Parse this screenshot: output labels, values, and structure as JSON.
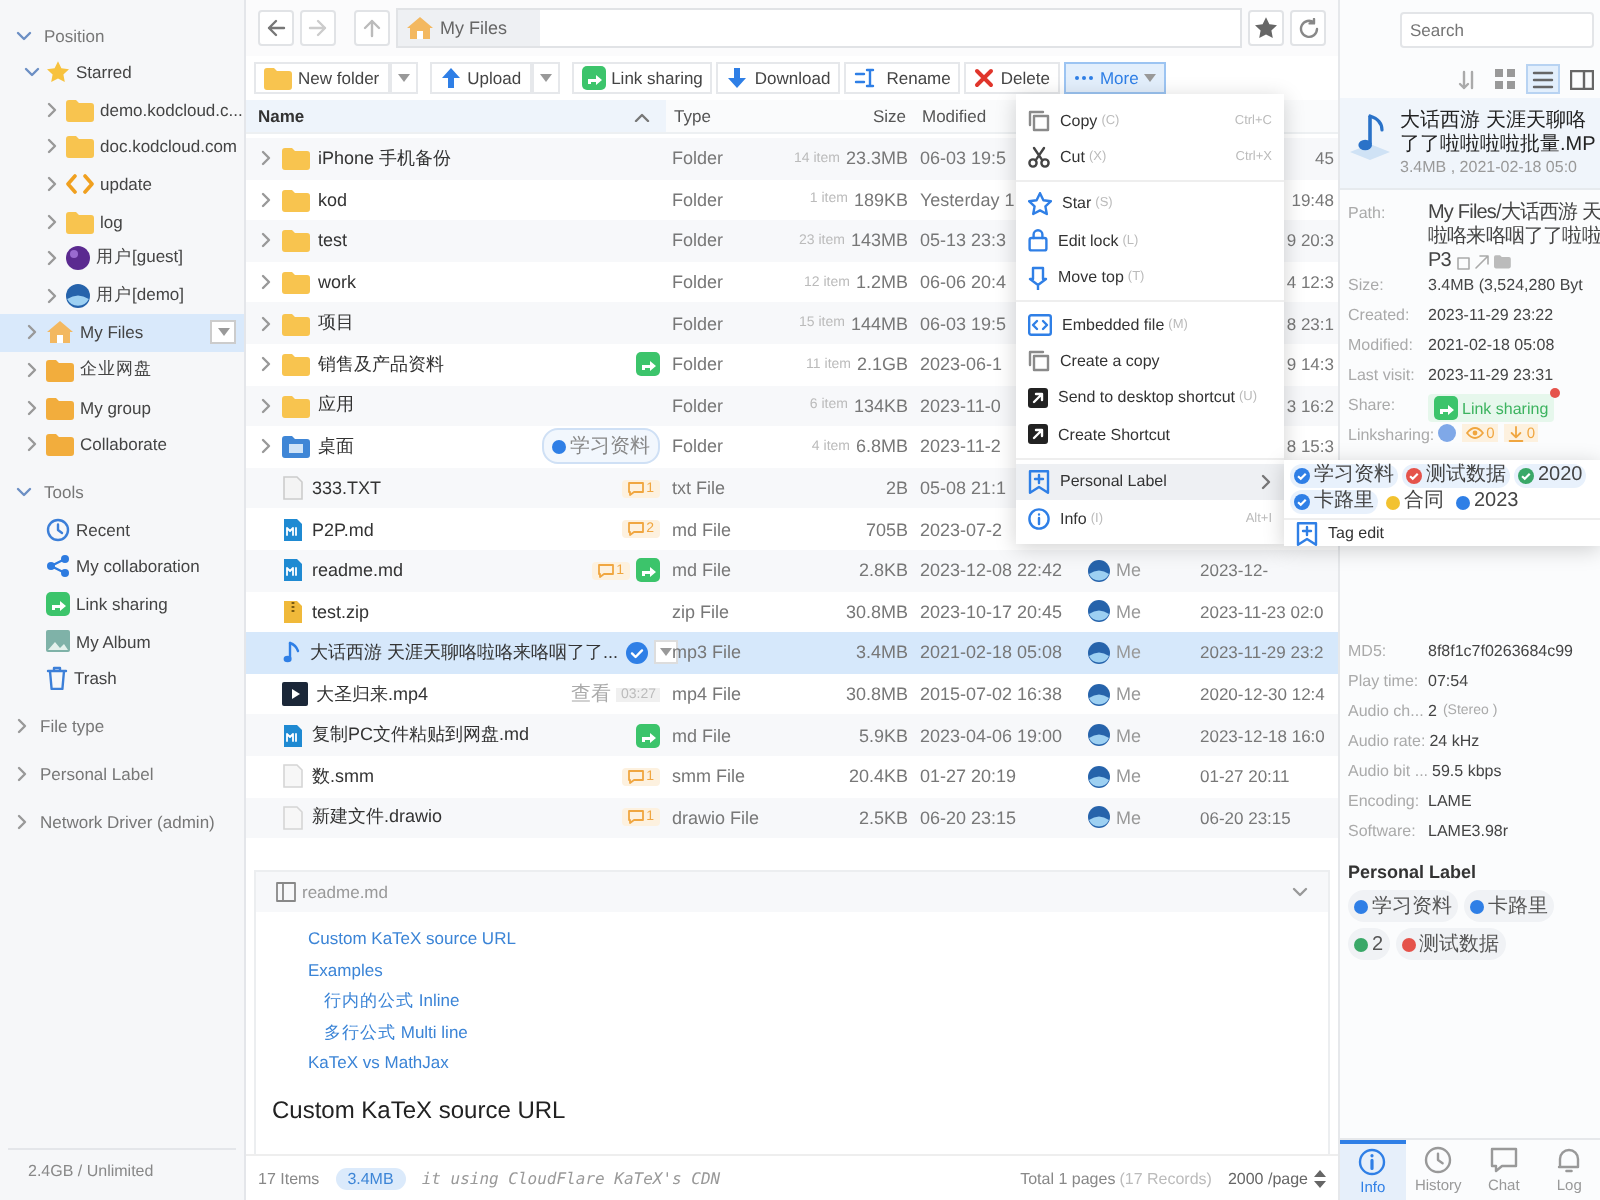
{
  "sidebar": {
    "sections": [
      {
        "title": "Position",
        "expanded": true,
        "items": [
          {
            "label": "Starred",
            "kind": "star",
            "expanded": true,
            "selected": false,
            "children": [
              {
                "label": "demo.kodcloud.c...",
                "kind": "folder",
                "expanded": false,
                "selected": false
              },
              {
                "label": "doc.kodcloud.com",
                "kind": "folder",
                "expanded": false,
                "selected": false
              },
              {
                "label": "update",
                "kind": "code",
                "expanded": false,
                "selected": false
              },
              {
                "label": "log",
                "kind": "folder",
                "expanded": false,
                "selected": false
              },
              {
                "label": "用户[guest]",
                "kind": "user-purple",
                "expanded": false,
                "selected": false
              },
              {
                "label": "用户[demo]",
                "kind": "user-blue",
                "expanded": false,
                "selected": false
              }
            ]
          },
          {
            "label": "My Files",
            "kind": "home",
            "expanded": false,
            "selected": true,
            "menu": true
          },
          {
            "label": "企业网盘",
            "kind": "folder-orange",
            "expanded": false,
            "selected": false
          },
          {
            "label": "My group",
            "kind": "folder-orange",
            "expanded": false,
            "selected": false
          },
          {
            "label": "Collaborate",
            "kind": "folder-orange",
            "expanded": false,
            "selected": false
          }
        ]
      },
      {
        "title": "Tools",
        "expanded": true,
        "items": [
          {
            "label": "Recent",
            "kind": "recent",
            "selected": false
          },
          {
            "label": "My collaboration",
            "kind": "collab",
            "selected": false
          },
          {
            "label": "Link sharing",
            "kind": "link-share",
            "selected": false
          },
          {
            "label": "My Album",
            "kind": "album",
            "selected": false
          },
          {
            "label": "Trash",
            "kind": "trash",
            "selected": false
          }
        ]
      },
      {
        "title": "File type",
        "expanded": false
      },
      {
        "title": "Personal Label",
        "expanded": false
      },
      {
        "title": "Network Driver (admin)",
        "expanded": false
      }
    ],
    "storage": "2.4GB / Unlimited"
  },
  "address_bar": {
    "breadcrumb": "My Files"
  },
  "search": {
    "placeholder": "Search"
  },
  "toolbar": [
    {
      "label": "New folder",
      "kind": "new-folder",
      "dropdown": true,
      "selected": false
    },
    {
      "label": "Upload",
      "kind": "upload",
      "dropdown": true,
      "selected": false
    },
    {
      "label": "Link sharing",
      "kind": "share",
      "dropdown": false,
      "selected": false
    },
    {
      "label": "Download",
      "kind": "download",
      "dropdown": false,
      "selected": false
    },
    {
      "label": "Rename",
      "kind": "rename",
      "dropdown": false,
      "selected": false
    },
    {
      "label": "Delete",
      "kind": "delete",
      "dropdown": false,
      "selected": false
    },
    {
      "label": "More",
      "kind": "more",
      "dropdown": true,
      "selected": true
    }
  ],
  "view_modes": [
    {
      "kind": "sort",
      "selected": false
    },
    {
      "kind": "grid",
      "selected": false
    },
    {
      "kind": "list",
      "selected": true
    },
    {
      "kind": "split",
      "selected": false
    }
  ],
  "table": {
    "columns": [
      {
        "label": "Name",
        "sorted": true
      },
      {
        "label": "Type"
      },
      {
        "label": "Size"
      },
      {
        "label": "Modified"
      }
    ],
    "rows": [
      {
        "name": "iPhone 手机备份",
        "kind": "folder",
        "expanded": false,
        "selected": false,
        "badges": [],
        "type": "Folder",
        "count": "14 item",
        "size": "23.3MB",
        "modified": "06-03 19:5",
        "visit": "45"
      },
      {
        "name": "kod",
        "kind": "folder",
        "expanded": false,
        "selected": false,
        "badges": [],
        "type": "Folder",
        "count": "1 item",
        "size": "189KB",
        "modified": "Yesterday 1",
        "visit": "19:48"
      },
      {
        "name": "test",
        "kind": "folder",
        "expanded": false,
        "selected": false,
        "badges": [],
        "type": "Folder",
        "count": "23 item",
        "size": "143MB",
        "modified": "05-13 23:3",
        "visit": "9 20:3"
      },
      {
        "name": "work",
        "kind": "folder",
        "expanded": false,
        "selected": false,
        "badges": [],
        "type": "Folder",
        "count": "12 item",
        "size": "1.2MB",
        "modified": "06-06 20:4",
        "visit": "4 12:3"
      },
      {
        "name": "项目",
        "kind": "folder",
        "expanded": false,
        "selected": false,
        "badges": [],
        "type": "Folder",
        "count": "15 item",
        "size": "144MB",
        "modified": "06-03 19:5",
        "visit": "8 23:1"
      },
      {
        "name": "销售及产品资料",
        "kind": "folder",
        "expanded": false,
        "selected": false,
        "badges": [
          {
            "kind": "share"
          }
        ],
        "type": "Folder",
        "count": "11 item",
        "size": "2.1GB",
        "modified": "2023-06-1",
        "visit": "9 14:3"
      },
      {
        "name": "应用",
        "kind": "folder",
        "expanded": false,
        "selected": false,
        "badges": [],
        "type": "Folder",
        "count": "6 item",
        "size": "134KB",
        "modified": "2023-11-0",
        "visit": "3 16:2"
      },
      {
        "name": "桌面",
        "kind": "desktop",
        "expanded": false,
        "selected": false,
        "badges": [
          {
            "kind": "tag",
            "text": "学习资料",
            "color": "#2f7fe6"
          }
        ],
        "type": "Folder",
        "count": "4 item",
        "size": "6.8MB",
        "modified": "2023-11-2",
        "visit": "8 15:3"
      },
      {
        "name": "333.TXT",
        "kind": "txt",
        "selected": false,
        "badges": [
          {
            "kind": "comment",
            "text": "1"
          }
        ],
        "type": "txt File",
        "size": "2B",
        "modified": "05-08 21:1"
      },
      {
        "name": "P2P.md",
        "kind": "md",
        "selected": false,
        "badges": [
          {
            "kind": "comment",
            "text": "2"
          }
        ],
        "type": "md File",
        "size": "705B",
        "modified": "2023-07-2"
      },
      {
        "name": "readme.md",
        "kind": "md",
        "selected": false,
        "badges": [
          {
            "kind": "comment",
            "text": "1"
          },
          {
            "kind": "share"
          }
        ],
        "type": "md File",
        "size": "2.8KB",
        "modified": "2023-12-08 22:42",
        "creator": "Me",
        "visit": "2023-12-"
      },
      {
        "name": "test.zip",
        "kind": "zip",
        "selected": false,
        "badges": [],
        "type": "zip File",
        "size": "30.8MB",
        "modified": "2023-10-17 20:45",
        "creator": "Me",
        "visit": "2023-11-23 02:0"
      },
      {
        "name": "大话西游 天涯天聊咯啦咯来咯咽了了...",
        "kind": "audio",
        "selected": true,
        "badges": [
          {
            "kind": "check"
          },
          {
            "kind": "dropdown"
          }
        ],
        "type": "mp3 File",
        "size": "3.4MB",
        "modified": "2021-02-18 05:08",
        "creator": "Me",
        "visit": "2023-11-29 23:2"
      },
      {
        "name": "大圣归来.mp4",
        "kind": "video",
        "selected": false,
        "badges": [
          {
            "kind": "text",
            "text": "查看"
          },
          {
            "kind": "duration",
            "text": "03:27"
          }
        ],
        "type": "mp4 File",
        "size": "30.8MB",
        "modified": "2015-07-02 16:38",
        "creator": "Me",
        "visit": "2020-12-30 12:4"
      },
      {
        "name": "复制PC文件粘贴到网盘.md",
        "kind": "md",
        "selected": false,
        "badges": [
          {
            "kind": "share"
          }
        ],
        "type": "md File",
        "size": "5.9KB",
        "modified": "2023-04-06 19:00",
        "creator": "Me",
        "visit": "2023-12-18 16:0"
      },
      {
        "name": "数.smm",
        "kind": "doc",
        "selected": false,
        "badges": [
          {
            "kind": "comment",
            "text": "1"
          }
        ],
        "type": "smm File",
        "size": "20.4KB",
        "modified": "01-27 20:19",
        "creator": "Me",
        "visit": "01-27 20:11"
      },
      {
        "name": "新建文件.drawio",
        "kind": "doc",
        "selected": false,
        "badges": [
          {
            "kind": "comment",
            "text": "1"
          }
        ],
        "type": "drawio File",
        "size": "2.5KB",
        "modified": "06-20 23:15",
        "creator": "Me",
        "visit": "06-20 23:15"
      }
    ]
  },
  "context_menu": [
    {
      "kind": "copy",
      "label": "Copy",
      "hint": "(C)",
      "shortcut": "Ctrl+C",
      "selected": false
    },
    {
      "kind": "cut",
      "label": "Cut",
      "hint": "(X)",
      "shortcut": "Ctrl+X",
      "selected": false
    },
    {
      "kind": "divider"
    },
    {
      "kind": "star",
      "label": "Star",
      "hint": "(S)",
      "selected": false
    },
    {
      "kind": "lock",
      "label": "Edit lock",
      "hint": "(L)",
      "selected": false
    },
    {
      "kind": "pin",
      "label": "Move top",
      "hint": "(T)",
      "selected": false
    },
    {
      "kind": "divider"
    },
    {
      "kind": "embed",
      "label": "Embedded file",
      "hint": "(M)",
      "selected": false
    },
    {
      "kind": "copy",
      "label": "Create a copy",
      "selected": false
    },
    {
      "kind": "shortcut",
      "label": "Send to desktop shortcut",
      "hint": "(U)",
      "selected": false
    },
    {
      "kind": "shortcut",
      "label": "Create Shortcut",
      "selected": false
    },
    {
      "kind": "divider"
    },
    {
      "kind": "label",
      "label": "Personal Label",
      "submenu": true,
      "selected": true
    },
    {
      "kind": "info",
      "label": "Info",
      "hint": "(I)",
      "shortcut": "Alt+I",
      "selected": false
    }
  ],
  "label_submenu": {
    "tags": [
      {
        "label": "学习资料",
        "color": "#2f7fe6",
        "checked": true
      },
      {
        "label": "测试数据",
        "color": "#e5534b",
        "checked": true
      },
      {
        "label": "2020",
        "color": "#3aa868",
        "checked": true
      },
      {
        "label": "卡路里",
        "color": "#2f7fe6",
        "checked": true
      },
      {
        "label": "合同",
        "color": "#f2c230",
        "checked": false
      },
      {
        "label": "2023",
        "color": "#2f7fe6",
        "checked": false
      }
    ],
    "action": "Tag edit"
  },
  "readme": {
    "title": "readme.md",
    "toc": [
      {
        "label": "Custom KaTeX source URL"
      },
      {
        "label": "Examples",
        "children": [
          {
            "label": "行内的公式 Inline"
          },
          {
            "label": "多行公式 Multi line"
          }
        ]
      },
      {
        "label": "KaTeX vs MathJax"
      }
    ],
    "heading": "Custom KaTeX source URL",
    "code": "it using CloudFlare KaTeX's CDN"
  },
  "status_bar": {
    "items": "17 Items",
    "selection": "3.4MB",
    "pages": "Total 1 pages",
    "records": "(17 Records)",
    "per_page": "2000 /page"
  },
  "info_panel": {
    "title_lines": [
      "大话西游 天涯天聊咯",
      "了了啦啦啦啦批量.MP"
    ],
    "subtitle": "3.4MB , 2021-02-18 05:0",
    "properties": [
      {
        "kind": "path",
        "label": "Path:",
        "lines": [
          "My Files/大话西游 天",
          "啦咯来咯咽了了啦啦",
          "P3"
        ]
      },
      {
        "kind": "text",
        "label": "Size:",
        "value": "3.4MB (3,524,280 Byt"
      },
      {
        "kind": "text",
        "label": "Created:",
        "value": "2023-11-29 23:22"
      },
      {
        "kind": "text",
        "label": "Modified:",
        "value": "2021-02-18 05:08"
      },
      {
        "kind": "text",
        "label": "Last visit:",
        "value": "2023-11-29 23:31"
      },
      {
        "kind": "share",
        "label": "Share:",
        "value": "Link sharing",
        "notify": true
      },
      {
        "kind": "counts",
        "label": "Linksharing:",
        "values": [
          "0",
          "0"
        ]
      }
    ],
    "media": [
      {
        "label": "MD5:",
        "value": "8f8f1c7f0263684c99"
      },
      {
        "label": "Play time:",
        "value": "07:54"
      },
      {
        "label": "Audio ch...",
        "value": "2",
        "note": "(Stereo )"
      },
      {
        "label": "Audio rate:",
        "value": "24 kHz"
      },
      {
        "label": "Audio bit ...",
        "value": "59.5 kbps"
      },
      {
        "label": "Encoding:",
        "value": "LAME"
      },
      {
        "label": "Software:",
        "value": "LAME3.98r"
      }
    ],
    "labels_title": "Personal Label",
    "labels": [
      {
        "label": "学习资料",
        "color": "#2f7fe6"
      },
      {
        "label": "卡路里",
        "color": "#2f7fe6"
      },
      {
        "label": "2",
        "color": "#3aa868"
      },
      {
        "label": "测试数据",
        "color": "#e5534b"
      }
    ],
    "tabs": [
      {
        "label": "Info",
        "kind": "info",
        "selected": true
      },
      {
        "label": "History",
        "kind": "history",
        "selected": false
      },
      {
        "label": "Chat",
        "kind": "chat",
        "selected": false
      },
      {
        "label": "Log",
        "kind": "log",
        "selected": false
      }
    ]
  }
}
